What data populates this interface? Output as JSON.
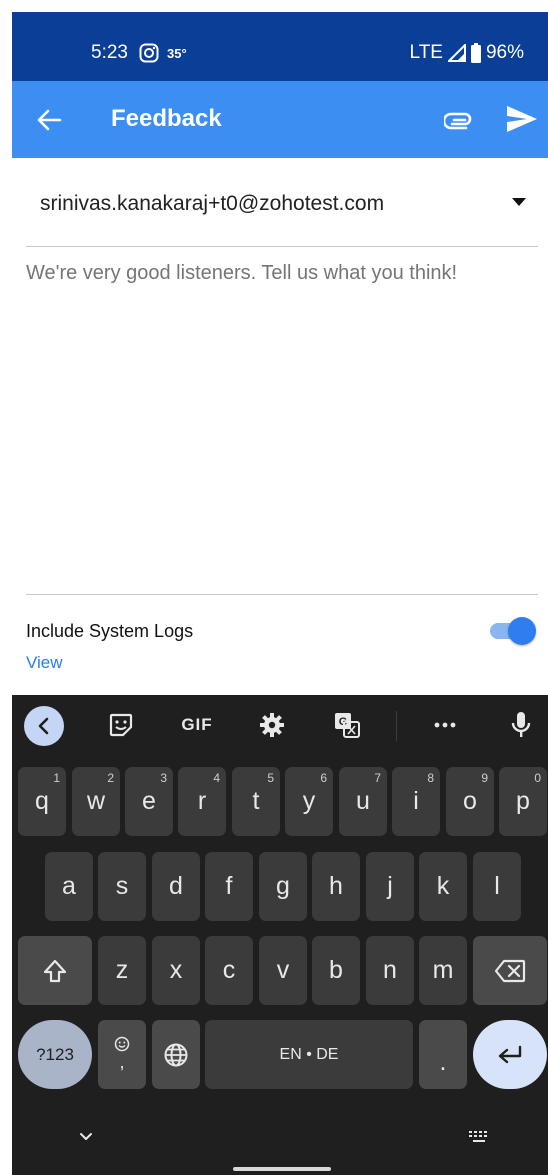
{
  "status_bar": {
    "time": "5:23",
    "temperature": "35°",
    "network": "LTE",
    "battery": "96%"
  },
  "app_bar": {
    "title": "Feedback",
    "icons": [
      "back-arrow-icon",
      "paperclip-icon",
      "send-icon"
    ]
  },
  "form": {
    "from_email": "srinivas.kanakaraj+t0@zohotest.com",
    "message_placeholder": "We're very good listeners. Tell us what you think!",
    "message_value": "",
    "include_logs_label": "Include System Logs",
    "include_logs_enabled": true,
    "view_link": "View"
  },
  "keyboard": {
    "toolbar": {
      "gif_label": "GIF"
    },
    "rows": {
      "row1": [
        {
          "k": "q",
          "h": "1"
        },
        {
          "k": "w",
          "h": "2"
        },
        {
          "k": "e",
          "h": "3"
        },
        {
          "k": "r",
          "h": "4"
        },
        {
          "k": "t",
          "h": "5"
        },
        {
          "k": "y",
          "h": "6"
        },
        {
          "k": "u",
          "h": "7"
        },
        {
          "k": "i",
          "h": "8"
        },
        {
          "k": "o",
          "h": "9"
        },
        {
          "k": "p",
          "h": "0"
        }
      ],
      "row2": [
        "a",
        "s",
        "d",
        "f",
        "g",
        "h",
        "j",
        "k",
        "l"
      ],
      "row3": [
        "z",
        "x",
        "c",
        "v",
        "b",
        "n",
        "m"
      ]
    },
    "symbols_label": "?123",
    "emoji_comma": ",",
    "space_label": "EN • DE",
    "period": "."
  },
  "colors": {
    "status_bar": "#0b3f97",
    "app_bar": "#3d8ef2",
    "link": "#2a7de1",
    "keyboard_bg": "#1f1f1f",
    "key_bg": "#3b3b3b"
  }
}
